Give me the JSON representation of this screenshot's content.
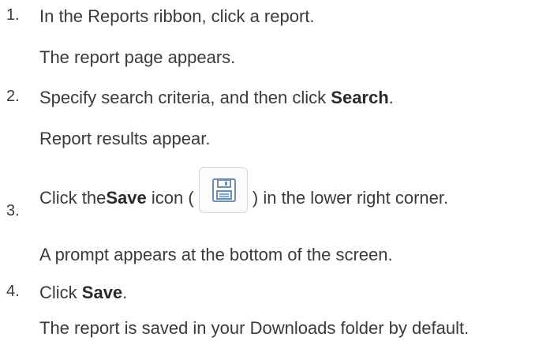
{
  "steps": [
    {
      "number": "1.",
      "before": "In the Reports ribbon, click a report.",
      "result": "The report page appears."
    },
    {
      "number": "2.",
      "before": "Specify search criteria, and then click ",
      "bold": "Search",
      "after": ".",
      "result": "Report results appear."
    },
    {
      "number": "3.",
      "before": "Click the ",
      "bold": "Save",
      "mid": " icon ( ",
      "icon": "save-floppy-icon",
      "after": " ) in the lower right corner.",
      "result": "A prompt appears at the bottom of the screen."
    },
    {
      "number": "4.",
      "before": "Click ",
      "bold": "Save",
      "after": ".",
      "result": "The report is saved in your Downloads folder by default."
    }
  ],
  "colors": {
    "text": "#3a3a3a",
    "icon_stroke": "#6b8fb5",
    "icon_border": "#d4d4d4"
  }
}
